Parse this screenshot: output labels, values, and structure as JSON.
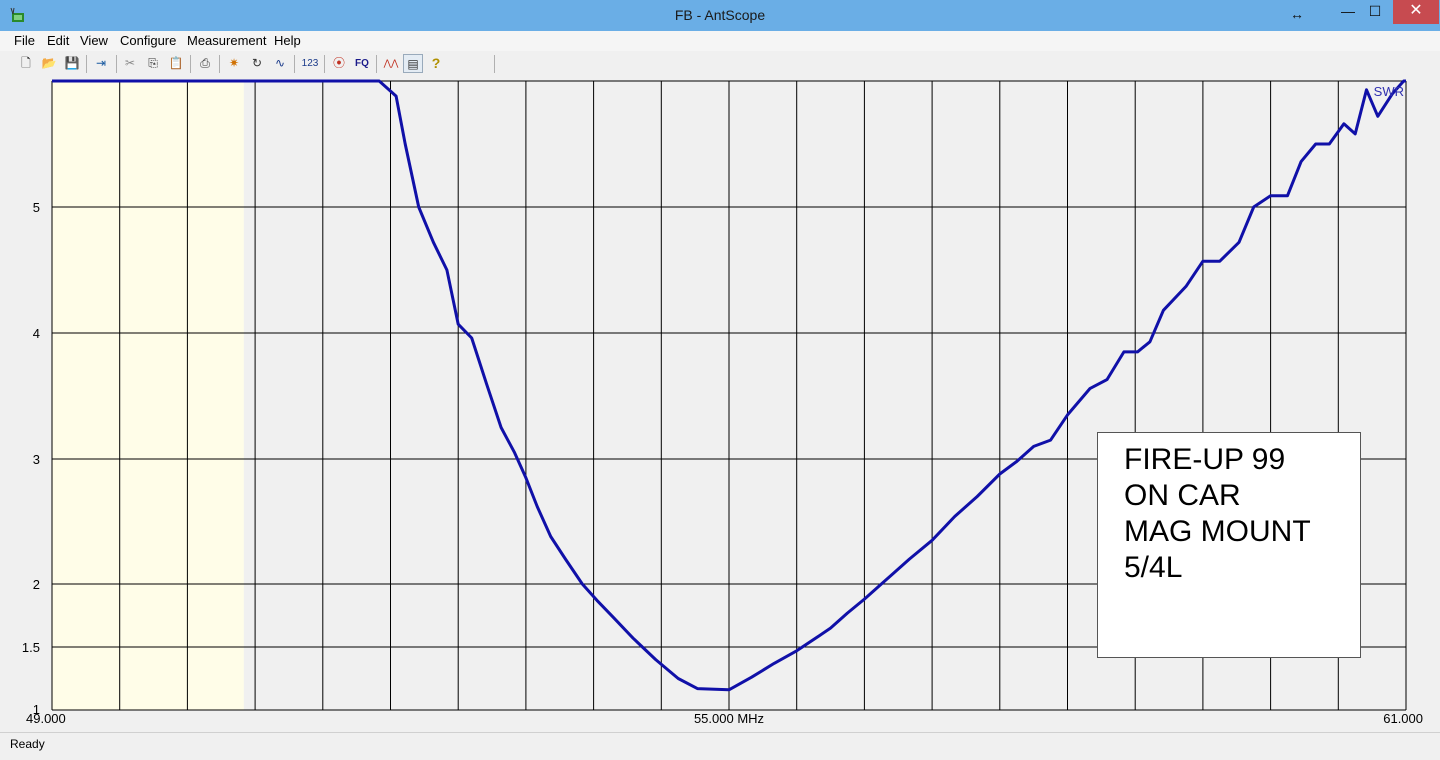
{
  "window": {
    "title": "FB - AntScope",
    "restore_glyph": "↔",
    "min_glyph": "—",
    "max_glyph": "☐",
    "close_glyph": "✕"
  },
  "menu": {
    "items": [
      {
        "label": "File"
      },
      {
        "label": "Edit"
      },
      {
        "label": "View"
      },
      {
        "label": "Configure"
      },
      {
        "label": "Measurement"
      },
      {
        "label": "Help"
      }
    ]
  },
  "toolbar": {
    "buttons": [
      {
        "name": "new-file-icon",
        "glyph": "🗋",
        "color": "#222222"
      },
      {
        "name": "open-folder-icon",
        "glyph": "📂",
        "color": "#c79a1a"
      },
      {
        "name": "save-icon",
        "glyph": "💾",
        "color": "#1a3a8a"
      },
      {
        "name": "export-icon",
        "glyph": "⇥",
        "color": "#1a5aa0"
      },
      {
        "name": "cut-icon",
        "glyph": "✂",
        "color": "#888888"
      },
      {
        "name": "copy-icon",
        "glyph": "⎘",
        "color": "#333333"
      },
      {
        "name": "paste-icon",
        "glyph": "📋",
        "color": "#888888"
      },
      {
        "name": "print-icon",
        "glyph": "⎙",
        "color": "#333333"
      },
      {
        "name": "measure-icon",
        "glyph": "✷",
        "color": "#d07000"
      },
      {
        "name": "refresh-icon",
        "glyph": "↻",
        "color": "#333333"
      },
      {
        "name": "graph-icon",
        "glyph": "∿",
        "color": "#1a3a8a"
      },
      {
        "name": "numeric-icon",
        "glyph": "123",
        "color": "#1a3a8a"
      },
      {
        "name": "antenna-icon",
        "glyph": "⦿",
        "color": "#c03020"
      },
      {
        "name": "fq-icon",
        "glyph": "FQ",
        "color": "#1a1a8a"
      },
      {
        "name": "curves-icon",
        "glyph": "⋀⋀",
        "color": "#c03020"
      },
      {
        "name": "options-icon",
        "glyph": "▤",
        "color": "#333333"
      },
      {
        "name": "help-icon",
        "glyph": "?",
        "color": "#b09000"
      }
    ]
  },
  "status": {
    "text": "Ready"
  },
  "note": {
    "lines": [
      "FIRE-UP 99",
      "ON CAR",
      "MAG MOUNT",
      "5/4L"
    ]
  },
  "colors": {
    "curve": "#1010a8",
    "grid": "#000000",
    "plot_bg": "#f0f0f0",
    "highlight_band": "#fffde8",
    "swr_label": "#3030b0"
  },
  "chart_data": {
    "type": "line",
    "title": "",
    "xlabel": "55.000 MHz",
    "ylabel": "",
    "xlim": [
      49.0,
      61.0
    ],
    "ylim_display": [
      1,
      6
    ],
    "y_scale": "swr",
    "grid": true,
    "x_ticks": [
      {
        "value": 49.0,
        "label": "49.000"
      },
      {
        "value": 55.0,
        "label": "55.000 MHz"
      },
      {
        "value": 61.0,
        "label": "61.000"
      }
    ],
    "y_ticks": [
      {
        "value": 1,
        "label": "1"
      },
      {
        "value": 1.5,
        "label": "1.5"
      },
      {
        "value": 2,
        "label": "2"
      },
      {
        "value": 3,
        "label": "3"
      },
      {
        "value": 4,
        "label": "4"
      },
      {
        "value": 5,
        "label": "5"
      }
    ],
    "highlight_band": [
      49.0,
      50.7
    ],
    "series": [
      {
        "name": "SWR",
        "points": [
          [
            49.0,
            6
          ],
          [
            51.9,
            6
          ],
          [
            52.05,
            5.88
          ],
          [
            52.13,
            5.5
          ],
          [
            52.25,
            5.0
          ],
          [
            52.38,
            4.72
          ],
          [
            52.5,
            4.5
          ],
          [
            52.6,
            4.07
          ],
          [
            52.72,
            3.96
          ],
          [
            52.85,
            3.6
          ],
          [
            52.98,
            3.25
          ],
          [
            53.1,
            3.05
          ],
          [
            53.2,
            2.85
          ],
          [
            53.3,
            2.62
          ],
          [
            53.42,
            2.38
          ],
          [
            53.55,
            2.2
          ],
          [
            53.7,
            2.0
          ],
          [
            53.83,
            1.87
          ],
          [
            53.97,
            1.74
          ],
          [
            54.15,
            1.57
          ],
          [
            54.35,
            1.4
          ],
          [
            54.55,
            1.25
          ],
          [
            54.72,
            1.17
          ],
          [
            55.0,
            1.16
          ],
          [
            55.2,
            1.26
          ],
          [
            55.4,
            1.37
          ],
          [
            55.6,
            1.47
          ],
          [
            55.8,
            1.59
          ],
          [
            55.9,
            1.65
          ],
          [
            56.05,
            1.77
          ],
          [
            56.2,
            1.88
          ],
          [
            56.4,
            2.04
          ],
          [
            56.6,
            2.2
          ],
          [
            56.8,
            2.35
          ],
          [
            57.0,
            2.54
          ],
          [
            57.2,
            2.7
          ],
          [
            57.4,
            2.88
          ],
          [
            57.55,
            2.98
          ],
          [
            57.7,
            3.1
          ],
          [
            57.85,
            3.15
          ],
          [
            58.0,
            3.35
          ],
          [
            58.2,
            3.56
          ],
          [
            58.35,
            3.63
          ],
          [
            58.5,
            3.85
          ],
          [
            58.62,
            3.85
          ],
          [
            58.73,
            3.93
          ],
          [
            58.85,
            4.18
          ],
          [
            59.05,
            4.37
          ],
          [
            59.2,
            4.57
          ],
          [
            59.35,
            4.57
          ],
          [
            59.52,
            4.72
          ],
          [
            59.65,
            5.0
          ],
          [
            59.8,
            5.09
          ],
          [
            59.95,
            5.09
          ],
          [
            60.07,
            5.36
          ],
          [
            60.2,
            5.5
          ],
          [
            60.32,
            5.5
          ],
          [
            60.45,
            5.66
          ],
          [
            60.55,
            5.58
          ],
          [
            60.65,
            5.93
          ],
          [
            60.75,
            5.72
          ],
          [
            60.88,
            5.9
          ],
          [
            60.98,
            6
          ],
          [
            61.0,
            6
          ]
        ]
      }
    ]
  }
}
